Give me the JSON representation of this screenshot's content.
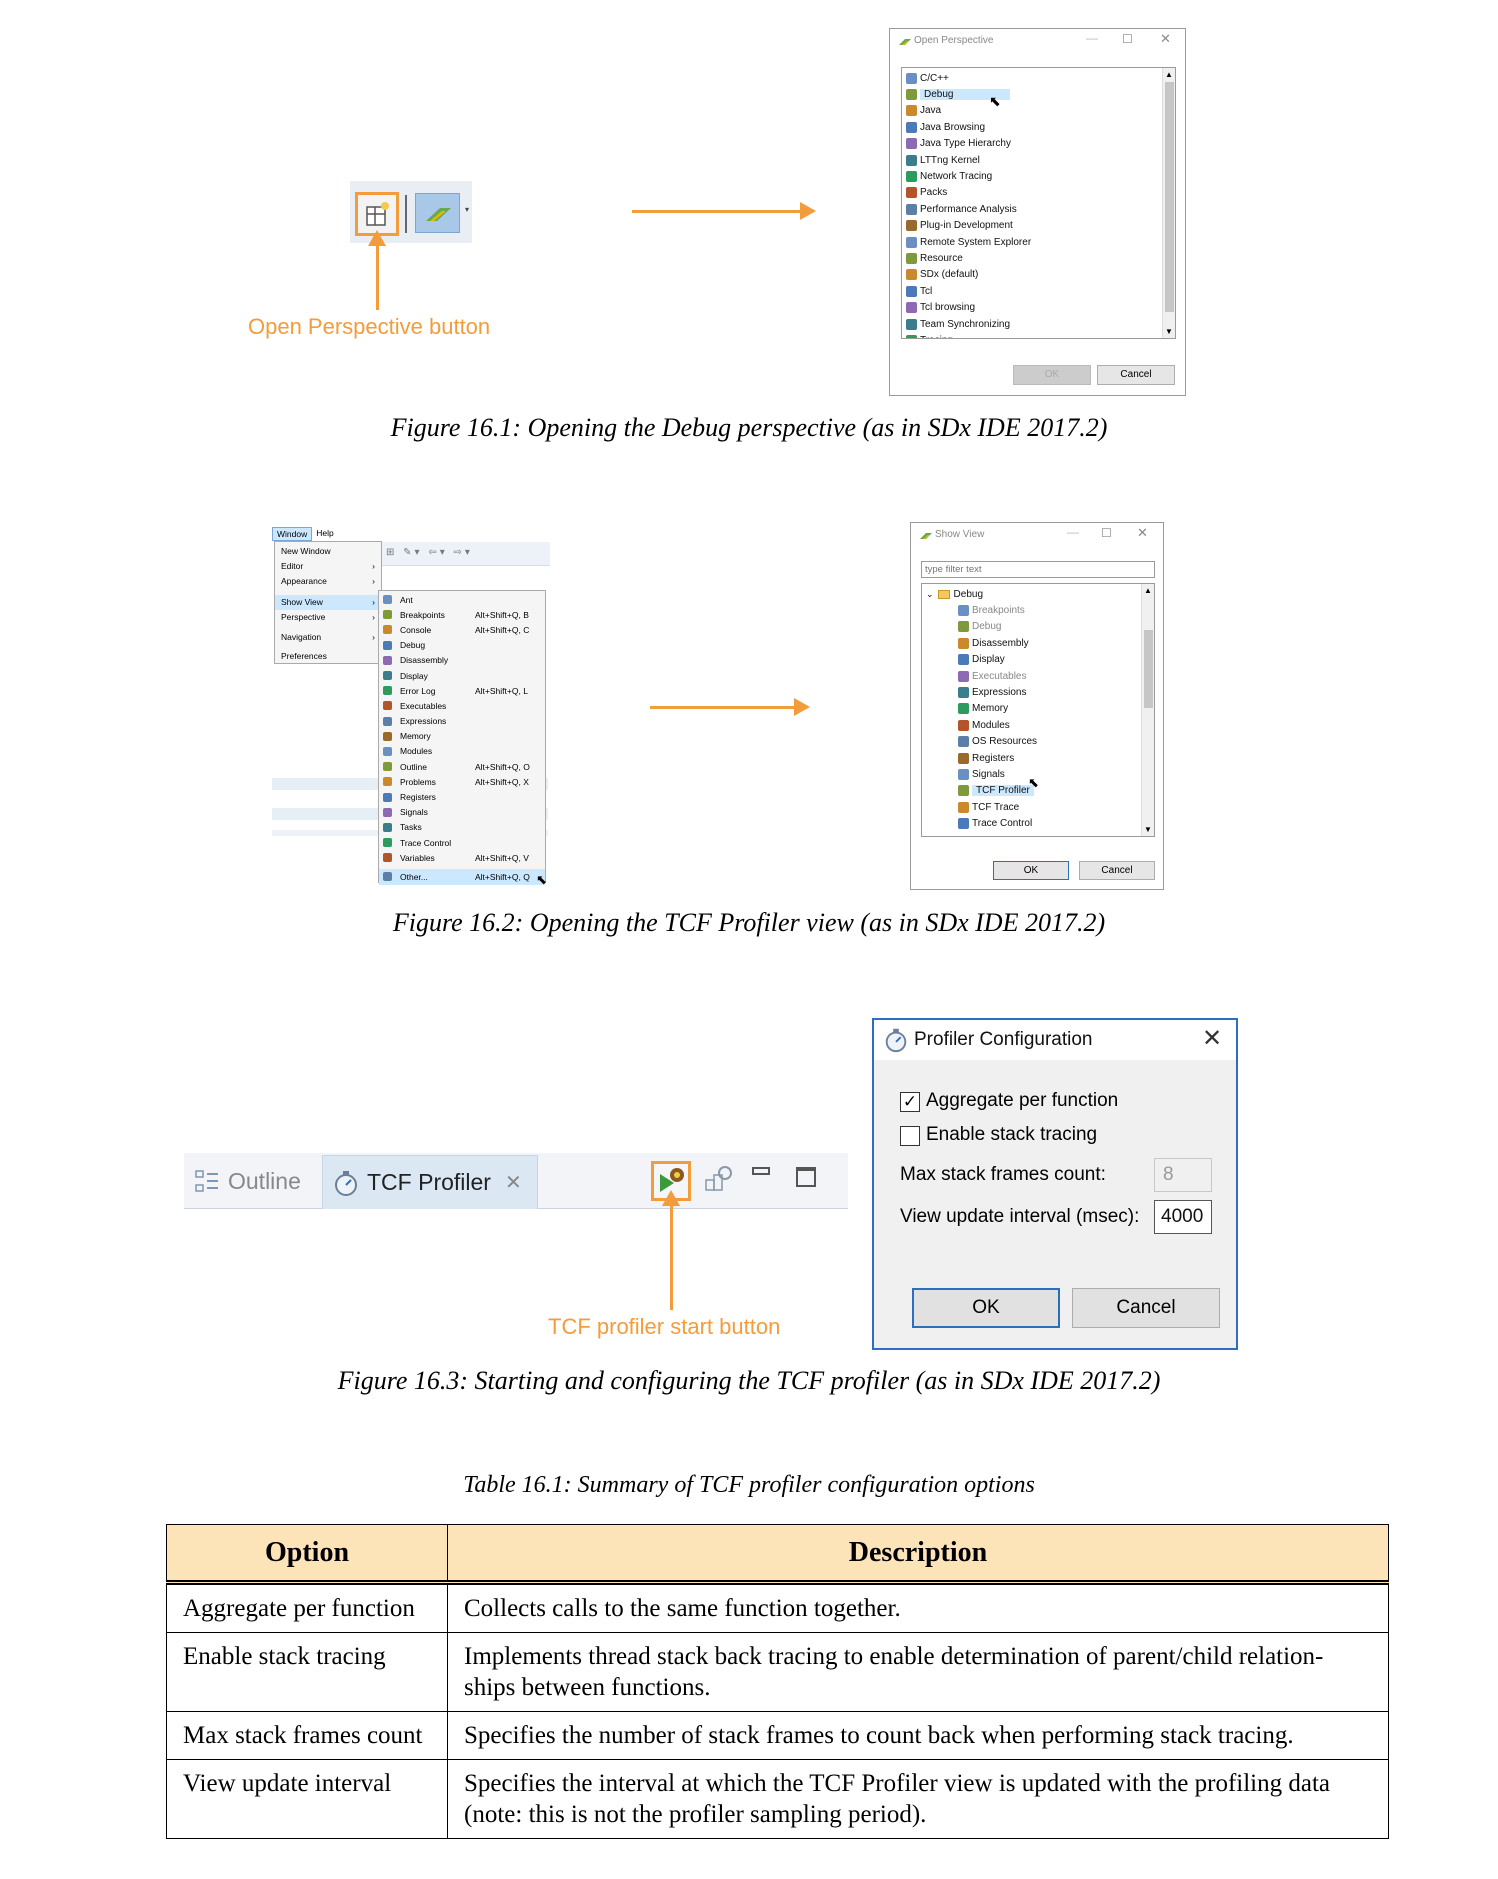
{
  "fig1": {
    "button_label": "Open Perspective button",
    "dialog_title": "Open Perspective",
    "items": [
      "C/C++",
      "Debug",
      "Java",
      "Java Browsing",
      "Java Type Hierarchy",
      "LTTng Kernel",
      "Network Tracing",
      "Packs",
      "Performance Analysis",
      "Plug-in Development",
      "Remote System Explorer",
      "Resource",
      "SDx (default)",
      "Tcl",
      "Tcl browsing",
      "Team Synchronizing",
      "Tracing"
    ],
    "ok": "OK",
    "cancel": "Cancel",
    "caption": "Figure 16.1:  Opening the Debug perspective (as in SDx IDE 2017.2)"
  },
  "fig2": {
    "menubar": [
      "Window",
      "Help"
    ],
    "window_menu": [
      {
        "label": "New Window",
        "arrow": ""
      },
      {
        "label": "Editor",
        "arrow": "›"
      },
      {
        "label": "Appearance",
        "arrow": "›"
      },
      {
        "label": "Show View",
        "arrow": "›"
      },
      {
        "label": "Perspective",
        "arrow": "›"
      },
      {
        "label": "Navigation",
        "arrow": "›"
      },
      {
        "label": "Preferences",
        "arrow": ""
      }
    ],
    "show_view_menu": [
      {
        "label": "Ant",
        "shortcut": ""
      },
      {
        "label": "Breakpoints",
        "shortcut": "Alt+Shift+Q, B"
      },
      {
        "label": "Console",
        "shortcut": "Alt+Shift+Q, C"
      },
      {
        "label": "Debug",
        "shortcut": ""
      },
      {
        "label": "Disassembly",
        "shortcut": ""
      },
      {
        "label": "Display",
        "shortcut": ""
      },
      {
        "label": "Error Log",
        "shortcut": "Alt+Shift+Q, L"
      },
      {
        "label": "Executables",
        "shortcut": ""
      },
      {
        "label": "Expressions",
        "shortcut": ""
      },
      {
        "label": "Memory",
        "shortcut": ""
      },
      {
        "label": "Modules",
        "shortcut": ""
      },
      {
        "label": "Outline",
        "shortcut": "Alt+Shift+Q, O"
      },
      {
        "label": "Problems",
        "shortcut": "Alt+Shift+Q, X"
      },
      {
        "label": "Registers",
        "shortcut": ""
      },
      {
        "label": "Signals",
        "shortcut": ""
      },
      {
        "label": "Tasks",
        "shortcut": ""
      },
      {
        "label": "Trace Control",
        "shortcut": ""
      },
      {
        "label": "Variables",
        "shortcut": "Alt+Shift+Q, V"
      },
      {
        "label": "Other...",
        "shortcut": "Alt+Shift+Q, Q"
      }
    ],
    "dialog_title": "Show View",
    "filter_placeholder": "type filter text",
    "folder": "Debug",
    "items": [
      "Breakpoints",
      "Debug",
      "Disassembly",
      "Display",
      "Executables",
      "Expressions",
      "Memory",
      "Modules",
      "OS Resources",
      "Registers",
      "Signals",
      "TCF Profiler",
      "TCF Trace",
      "Trace Control"
    ],
    "ok": "OK",
    "cancel": "Cancel",
    "caption": "Figure 16.2:  Opening the TCF Profiler view (as in SDx IDE 2017.2)"
  },
  "fig3": {
    "tab_outline": "Outline",
    "tab_profiler": "TCF Profiler",
    "start_label": "TCF profiler start button",
    "dialog_title": "Profiler Configuration",
    "aggregate": "Aggregate per function",
    "stack_tracing": "Enable stack tracing",
    "max_frames_label": "Max stack frames count:",
    "max_frames_value": "8",
    "interval_label": "View update interval (msec):",
    "interval_value": "4000",
    "ok": "OK",
    "cancel": "Cancel",
    "caption": "Figure 16.3:  Starting and configuring the TCF profiler (as in SDx IDE 2017.2)"
  },
  "table": {
    "caption": "Table 16.1: Summary of TCF profiler configuration options",
    "headers": [
      "Option",
      "Description"
    ],
    "rows": [
      [
        "Aggregate per function",
        "Collects calls to the same function together."
      ],
      [
        "Enable stack tracing",
        "Implements thread stack back tracing to enable determination of parent/child relation- ships between functions."
      ],
      [
        "Max stack frames count",
        "Specifies the number of stack frames to count back when performing stack tracing."
      ],
      [
        "View update interval",
        "Specifies the interval at which the TCF Profiler view is updated with the profiling data (note: this is not the profiler sampling period)."
      ]
    ]
  },
  "colors": {
    "accent": "#f39c3b",
    "header_bg": "#fde3b8",
    "selection": "#cce8ff",
    "dialog_border": "#2c6fbf"
  }
}
